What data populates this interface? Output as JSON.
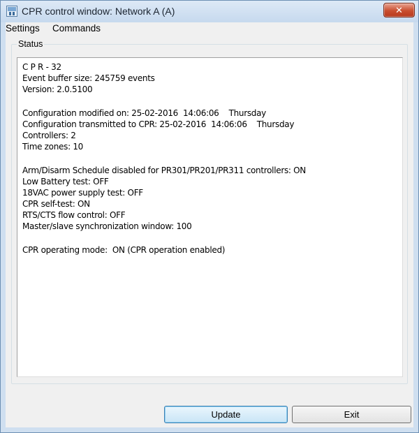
{
  "window": {
    "title": "CPR control window: Network A (A)",
    "close_symbol": "✕"
  },
  "menu": {
    "items": [
      "Settings",
      "Commands"
    ]
  },
  "status_group": {
    "label": "Status",
    "lines": [
      "C P R - 32",
      "Event buffer size: 245759 events",
      "Version: 2.0.5100",
      "",
      "Configuration modified on: 25-02-2016  14:06:06    Thursday",
      "Configuration transmitted to CPR: 25-02-2016  14:06:06    Thursday",
      "Controllers: 2",
      "Time zones: 10",
      "",
      "Arm/Disarm Schedule disabled for PR301/PR201/PR311 controllers: ON",
      "Low Battery test: OFF",
      "18VAC power supply test: OFF",
      "CPR self-test: ON",
      "RTS/CTS flow control: OFF",
      "Master/slave synchronization window: 100",
      "",
      "CPR operating mode:  ON (CPR operation enabled)"
    ]
  },
  "buttons": {
    "update_label": "Update",
    "exit_label": "Exit"
  },
  "colors": {
    "title_bar": "#c6d9ee",
    "close_button": "#c94e2f",
    "client_bg": "#f0f0f0",
    "default_button": "#c9e5f6"
  }
}
